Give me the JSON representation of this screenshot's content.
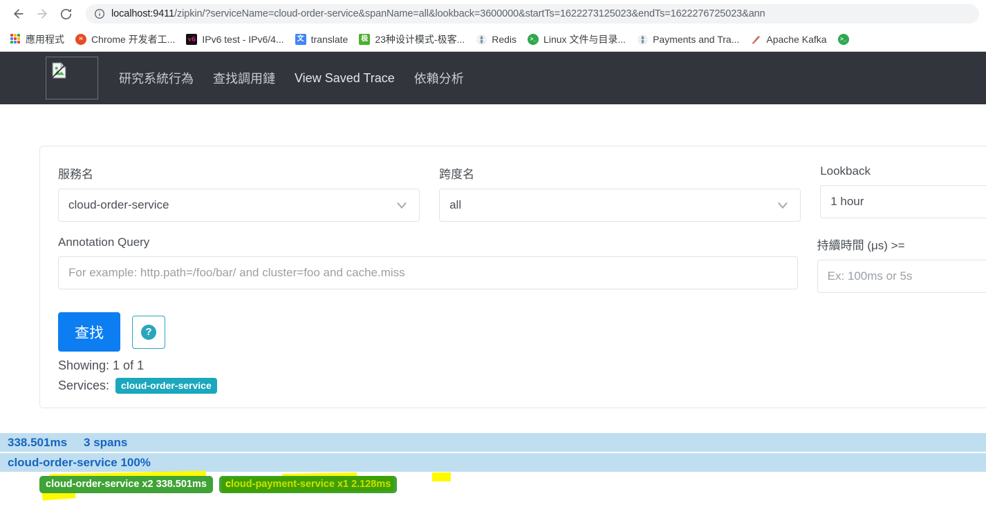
{
  "browser": {
    "back_icon": "back-arrow-icon",
    "forward_icon": "forward-arrow-icon",
    "reload_icon": "reload-icon",
    "site_info_icon": "info-circle-icon",
    "url_host": "localhost:9411",
    "url_path": "/zipkin/?serviceName=cloud-order-service&spanName=all&lookback=3600000&startTs=1622273125023&endTs=1622276725023&ann",
    "bookmarks": [
      {
        "label": "應用程式",
        "icon": "apps-grid-icon"
      },
      {
        "label": "Chrome 开发者工...",
        "icon": "html5-icon"
      },
      {
        "label": "IPv6 test - IPv6/4...",
        "icon": "ipv6-icon"
      },
      {
        "label": "translate",
        "icon": "google-translate-icon"
      },
      {
        "label": "23种设计模式-极客...",
        "icon": "jike-icon"
      },
      {
        "label": "Redis",
        "icon": "globe-icon"
      },
      {
        "label": "Linux 文件与目录...",
        "icon": "terminal-icon"
      },
      {
        "label": "Payments and Tra...",
        "icon": "globe-icon"
      },
      {
        "label": "Apache Kafka",
        "icon": "kafka-icon"
      },
      {
        "label": "",
        "icon": "terminal-icon"
      }
    ]
  },
  "navbar": {
    "logo_icon": "broken-image-placeholder-icon",
    "links": [
      {
        "label": "研究系統行為"
      },
      {
        "label": "查找調用鏈"
      },
      {
        "label": "View Saved Trace"
      },
      {
        "label": "依賴分析"
      }
    ]
  },
  "search": {
    "service_label": "服務名",
    "service_value": "cloud-order-service",
    "span_label": "跨度名",
    "span_value": "all",
    "lookback_label": "Lookback",
    "lookback_value": "1 hour",
    "annotation_label": "Annotation Query",
    "annotation_placeholder": "For example: http.path=/foo/bar/ and cluster=foo and cache.miss",
    "duration_label": "持續時間 (μs) >=",
    "duration_placeholder": "Ex: 100ms or 5s",
    "search_button": "查找",
    "help_button": "?",
    "showing": "Showing: 1 of 1",
    "services_label": "Services:",
    "services_badge": "cloud-order-service",
    "chevron_icon": "chevron-down-icon"
  },
  "results": {
    "duration": "338.501ms",
    "spans": "3 spans",
    "service_percent": "cloud-order-service 100%",
    "span_badges": [
      {
        "label": "cloud-order-service x2 338.501ms"
      },
      {
        "lead": "c",
        "label": "loud-payment-service x1 2.128ms"
      }
    ]
  },
  "colors": {
    "navbar_bg": "#32353c",
    "search_button": "#0c7ef2",
    "teal": "#1ba7bd",
    "trace_bar": "#bfdef0",
    "trace_text": "#1565c0",
    "span_badge": "#3fa335",
    "highlighter": "#fffa00"
  }
}
